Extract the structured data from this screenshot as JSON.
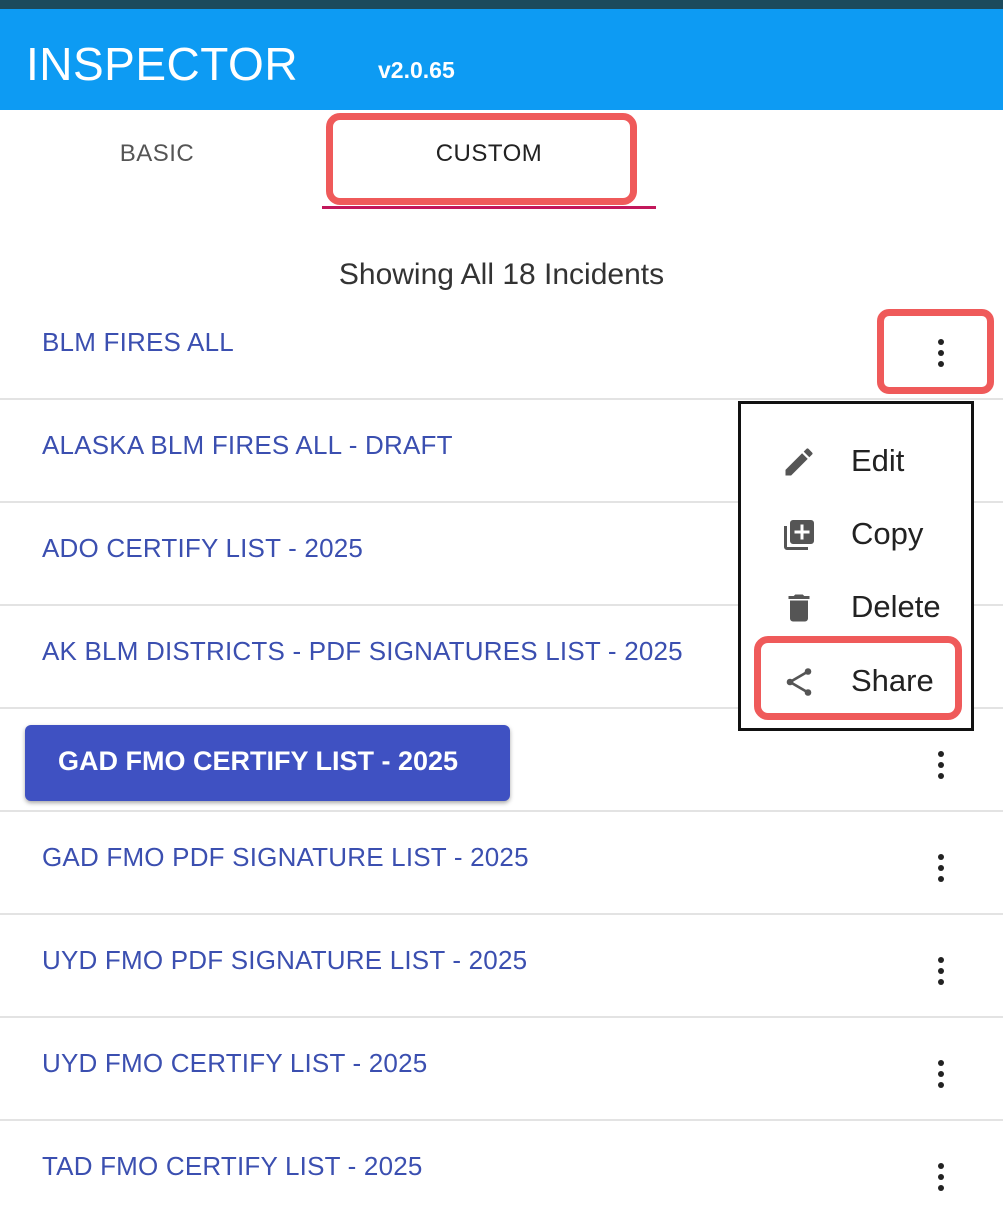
{
  "app": {
    "title": "INSPECTOR",
    "version": "v2.0.65"
  },
  "tabs": [
    {
      "label": "BASIC",
      "selected": false
    },
    {
      "label": "CUSTOM",
      "selected": true
    }
  ],
  "status": "Showing All 18 Incidents",
  "lists": [
    {
      "label": "BLM FIRES ALL"
    },
    {
      "label": "ALASKA BLM FIRES ALL - DRAFT"
    },
    {
      "label": "ADO CERTIFY LIST - 2025"
    },
    {
      "label": "AK BLM DISTRICTS - PDF SIGNATURES LIST - 2025"
    },
    {
      "label": "GAD FMO CERTIFY LIST - 2025",
      "selected": true
    },
    {
      "label": "GAD FMO PDF SIGNATURE LIST - 2025"
    },
    {
      "label": "UYD FMO PDF SIGNATURE LIST - 2025"
    },
    {
      "label": "UYD FMO CERTIFY LIST - 2025"
    },
    {
      "label": "TAD FMO CERTIFY LIST - 2025"
    }
  ],
  "menu": {
    "items": [
      {
        "label": "Edit",
        "icon": "pencil-icon"
      },
      {
        "label": "Copy",
        "icon": "copy-icon"
      },
      {
        "label": "Delete",
        "icon": "trash-icon"
      },
      {
        "label": "Share",
        "icon": "share-icon"
      }
    ]
  },
  "colors": {
    "header": "#0d9bf3",
    "accent_underline": "#c2185b",
    "link_text": "#3b4fb0",
    "selected_chip": "#3f51c2",
    "highlight": "#ef5a5a"
  }
}
